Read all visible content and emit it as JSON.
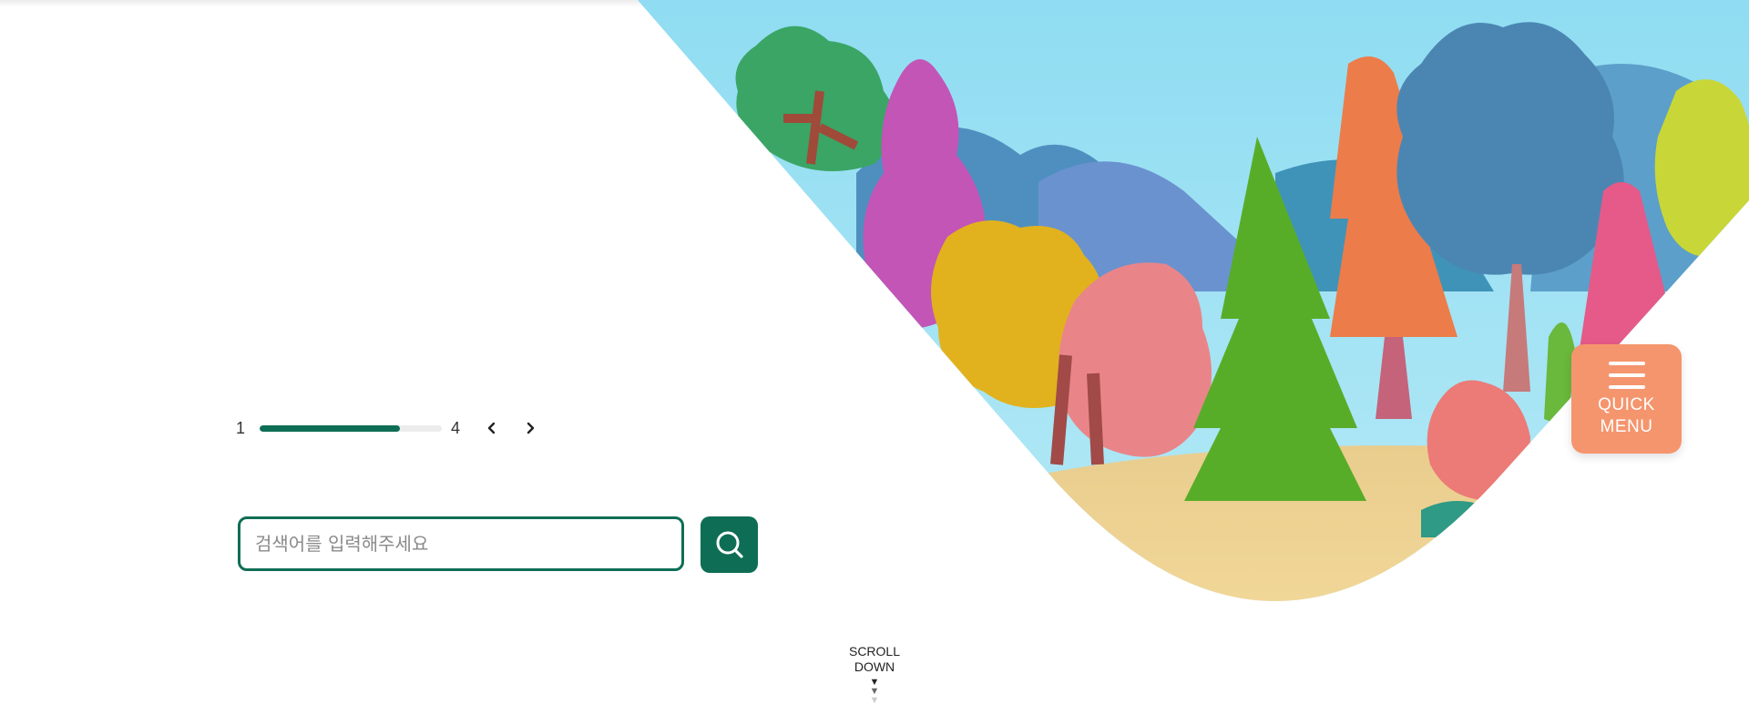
{
  "colors": {
    "brand_green": "#0e6e55",
    "quick_menu_bg": "#f5956d",
    "track_bg": "#ececec"
  },
  "slider": {
    "current": "1",
    "total": "4",
    "progress": 0.77,
    "prev_icon": "chevron-left-icon",
    "next_icon": "chevron-right-icon"
  },
  "search": {
    "placeholder": "검색어를 입력해주세요",
    "value": "",
    "button_icon": "search-icon"
  },
  "quick_menu": {
    "line1": "QUICK",
    "line2": "MENU",
    "icon": "hamburger-icon"
  },
  "scroll": {
    "line1": "SCROLL",
    "line2": "DOWN",
    "icon": "triangle-down-icon"
  },
  "hero": {
    "illustration": "watercolor forest trees"
  }
}
